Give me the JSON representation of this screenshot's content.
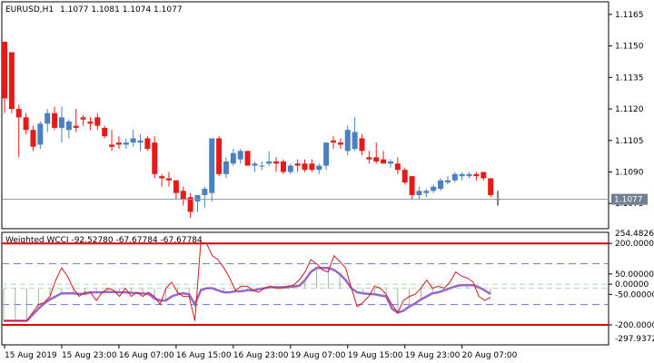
{
  "chart_data": [
    {
      "type": "candlestick",
      "symbol_label": "EURUSD,H1",
      "ohlc_label": "1.1077 1.1081 1.1074 1.1077",
      "ylim": [
        1.1063,
        1.1171
      ],
      "y_ticks": [
        "1.1165",
        "1.1150",
        "1.1135",
        "1.1120",
        "1.1105",
        "1.1090",
        "1.1075"
      ],
      "y_tick_values": [
        1.1165,
        1.115,
        1.1135,
        1.112,
        1.1105,
        1.109,
        1.1075
      ],
      "current_price": 1.1077,
      "current_price_label": "1.1077",
      "up_color": "#4a7fc0",
      "down_color": "#e41b1b",
      "candles": [
        [
          1.1152,
          1.1152,
          1.1118,
          1.1125
        ],
        [
          1.1147,
          1.1147,
          1.1118,
          1.112
        ],
        [
          1.112,
          1.1122,
          1.1097,
          1.1116
        ],
        [
          1.1116,
          1.1118,
          1.1108,
          1.111
        ],
        [
          1.111,
          1.1112,
          1.11,
          1.1102
        ],
        [
          1.1103,
          1.1114,
          1.1101,
          1.1113
        ],
        [
          1.1113,
          1.112,
          1.1109,
          1.1118
        ],
        [
          1.1118,
          1.1121,
          1.111,
          1.1111
        ],
        [
          1.1111,
          1.1121,
          1.1104,
          1.1116
        ],
        [
          1.111,
          1.1115,
          1.1106,
          1.1114
        ],
        [
          1.1112,
          1.112,
          1.1109,
          1.1111
        ],
        [
          1.1116,
          1.1117,
          1.1112,
          1.1115
        ],
        [
          1.1114,
          1.1116,
          1.111,
          1.1113
        ],
        [
          1.1116,
          1.1118,
          1.111,
          1.1112
        ],
        [
          1.1111,
          1.1112,
          1.1106,
          1.1107
        ],
        [
          1.1103,
          1.111,
          1.11,
          1.1102
        ],
        [
          1.1104,
          1.1107,
          1.1101,
          1.1103
        ],
        [
          1.1103,
          1.1106,
          1.1101,
          1.1104
        ],
        [
          1.1104,
          1.111,
          1.1102,
          1.1106
        ],
        [
          1.1104,
          1.1108,
          1.11,
          1.1105
        ],
        [
          1.1106,
          1.1107,
          1.11,
          1.1101
        ],
        [
          1.1104,
          1.1107,
          1.1087,
          1.1089
        ],
        [
          1.1088,
          1.1089,
          1.1083,
          1.1087
        ],
        [
          1.1087,
          1.109,
          1.1083,
          1.1086
        ],
        [
          1.1086,
          1.1086,
          1.1077,
          1.108
        ],
        [
          1.1081,
          1.1083,
          1.1074,
          1.1077
        ],
        [
          1.1078,
          1.108,
          1.1068,
          1.1071
        ],
        [
          1.1076,
          1.1079,
          1.1071,
          1.1079
        ],
        [
          1.1079,
          1.1083,
          1.1073,
          1.1082
        ],
        [
          1.108,
          1.1106,
          1.1076,
          1.1106
        ],
        [
          1.1106,
          1.1107,
          1.1088,
          1.1089
        ],
        [
          1.1089,
          1.1097,
          1.1087,
          1.1095
        ],
        [
          1.1094,
          1.1101,
          1.1093,
          1.1099
        ],
        [
          1.1096,
          1.1101,
          1.1094,
          1.11
        ],
        [
          1.11,
          1.11,
          1.1093,
          1.1093
        ],
        [
          1.1093,
          1.1095,
          1.109,
          1.1094
        ],
        [
          1.1093,
          1.1095,
          1.1091,
          1.1093
        ],
        [
          1.1094,
          1.11,
          1.1093,
          1.1095
        ],
        [
          1.1095,
          1.1097,
          1.109,
          1.1094
        ],
        [
          1.1095,
          1.1096,
          1.1089,
          1.109
        ],
        [
          1.109,
          1.1094,
          1.1089,
          1.1093
        ],
        [
          1.1094,
          1.1096,
          1.109,
          1.1093
        ],
        [
          1.1094,
          1.1096,
          1.109,
          1.1091
        ],
        [
          1.1094,
          1.1096,
          1.109,
          1.1091
        ],
        [
          1.1091,
          1.1094,
          1.1089,
          1.1093
        ],
        [
          1.1093,
          1.1104,
          1.1091,
          1.1104
        ],
        [
          1.1105,
          1.1107,
          1.1101,
          1.1104
        ],
        [
          1.1104,
          1.1106,
          1.1101,
          1.1103
        ],
        [
          1.11,
          1.1112,
          1.1098,
          1.111
        ],
        [
          1.1101,
          1.1116,
          1.11,
          1.1109
        ],
        [
          1.1106,
          1.1108,
          1.1098,
          1.11
        ],
        [
          1.1097,
          1.11,
          1.1094,
          1.1096
        ],
        [
          1.1097,
          1.1104,
          1.1094,
          1.1095
        ],
        [
          1.1096,
          1.11,
          1.1094,
          1.1094
        ],
        [
          1.1094,
          1.1096,
          1.1092,
          1.1095
        ],
        [
          1.1094,
          1.1097,
          1.1089,
          1.1091
        ],
        [
          1.1091,
          1.1092,
          1.1084,
          1.1085
        ],
        [
          1.1088,
          1.1088,
          1.1077,
          1.1079
        ],
        [
          1.1079,
          1.1083,
          1.1077,
          1.1081
        ],
        [
          1.108,
          1.1082,
          1.1078,
          1.1081
        ],
        [
          1.1081,
          1.1084,
          1.108,
          1.1083
        ],
        [
          1.1082,
          1.1087,
          1.1081,
          1.1086
        ],
        [
          1.1085,
          1.1088,
          1.1084,
          1.1086
        ],
        [
          1.1086,
          1.109,
          1.1085,
          1.1089
        ],
        [
          1.1088,
          1.109,
          1.1086,
          1.1089
        ],
        [
          1.1088,
          1.109,
          1.1087,
          1.1089
        ],
        [
          1.1089,
          1.109,
          1.1086,
          1.1088
        ],
        [
          1.109,
          1.109,
          1.1086,
          1.1087
        ],
        [
          1.1087,
          1.1087,
          1.1078,
          1.1079
        ],
        [
          1.1077,
          1.1081,
          1.1074,
          1.1077
        ]
      ],
      "x_tick_labels": [
        "15 Aug 2019",
        "15 Aug 23:00",
        "16 Aug 07:00",
        "16 Aug 15:00",
        "16 Aug 23:00",
        "19 Aug 07:00",
        "19 Aug 15:00",
        "19 Aug 23:00",
        "20 Aug 07:00"
      ],
      "x_tick_candle_index": [
        0,
        8,
        16,
        24,
        32,
        40,
        48,
        56,
        64
      ]
    },
    {
      "type": "indicator",
      "title": "Weighted WCCI -92.52780 -67.67784 -67.67784",
      "ylim": [
        -297.9372,
        254.48261
      ],
      "y_ticks": [
        "200.00000",
        "50.00000",
        "0.00000",
        "-50.00000",
        "-200.00000"
      ],
      "y_tick_values": [
        200,
        50,
        0,
        -50,
        -200
      ],
      "max_label": "254.48261",
      "min_label": "-297.93720",
      "levels_red": [
        200,
        -200
      ],
      "levels_blue_dashed": [
        100,
        -100
      ],
      "levels_green_dashed": [
        0,
        -20
      ],
      "cci_color": "#d11b1b",
      "smooth_color": "#9966cc",
      "hist_color": "#96b896",
      "cci": [
        -180,
        -180,
        -180,
        -180,
        -180,
        -140,
        -100,
        -90,
        -60,
        20,
        80,
        40,
        -20,
        -60,
        -40,
        -40,
        -80,
        -40,
        -20,
        -30,
        -60,
        -20,
        -60,
        -40,
        -60,
        -40,
        -60,
        -100,
        -20,
        10,
        -40,
        -60,
        -60,
        -180,
        205,
        200,
        140,
        120,
        80,
        30,
        -30,
        -10,
        -10,
        -30,
        -40,
        -20,
        -10,
        -20,
        -20,
        -10,
        -5,
        20,
        60,
        120,
        100,
        70,
        60,
        140,
        110,
        80,
        -20,
        -110,
        -90,
        -60,
        -10,
        -20,
        -50,
        -100,
        -140,
        -80,
        -60,
        -50,
        -20,
        20,
        -20,
        -10,
        -20,
        10,
        60,
        40,
        30,
        10,
        -60,
        -80,
        -65
      ],
      "smooth": [
        -180,
        -180,
        -180,
        -180,
        -180,
        -150,
        -120,
        -95,
        -75,
        -60,
        -45,
        -45,
        -45,
        -48,
        -48,
        -40,
        -40,
        -40,
        -38,
        -38,
        -40,
        -40,
        -42,
        -44,
        -46,
        -48,
        -70,
        -80,
        -80,
        -60,
        -50,
        -45,
        -50,
        -100,
        -30,
        -20,
        -20,
        -30,
        -40,
        -40,
        -35,
        -35,
        -30,
        -30,
        -25,
        -20,
        -15,
        -15,
        -15,
        -15,
        -12,
        -8,
        20,
        60,
        80,
        80,
        80,
        70,
        50,
        20,
        -20,
        -40,
        -45,
        -48,
        -50,
        -55,
        -60,
        -120,
        -140,
        -130,
        -110,
        -95,
        -75,
        -60,
        -45,
        -40,
        -30,
        -20,
        -10,
        -5,
        -5,
        -5,
        -15,
        -30,
        -48
      ]
    }
  ]
}
